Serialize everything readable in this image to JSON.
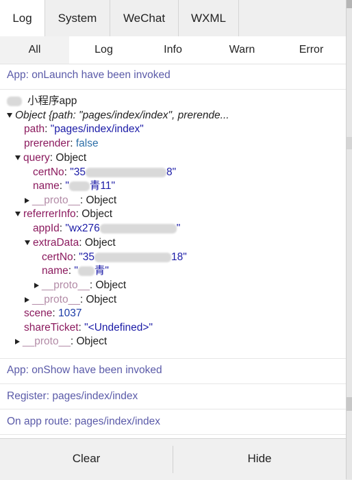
{
  "tabs": [
    "Log",
    "System",
    "WeChat",
    "WXML"
  ],
  "filters": [
    "All",
    "Log",
    "Info",
    "Warn",
    "Error"
  ],
  "logs": {
    "launch": "App: onLaunch have been invoked",
    "show": "App: onShow have been invoked",
    "register": "Register: pages/index/index",
    "route": "On app route: pages/index/index"
  },
  "obj": {
    "app_label": "小程序app",
    "summary": "Object {path: \"pages/index/index\", prerende...",
    "path_key": "path",
    "path_val": "\"pages/index/index\"",
    "prerender_key": "prerender",
    "prerender_val": "false",
    "query_key": "query",
    "object_word": "Object",
    "certNo_key": "certNo",
    "certNo_head": "\"35",
    "certNo_tail": "8\"",
    "certNo2_tail": "18\"",
    "name_key": "name",
    "name_head": "\"",
    "name_tail": "青11\"",
    "name2_tail": "青\"",
    "proto_key": "__proto__",
    "referrer_key": "referrerInfo",
    "appId_key": "appId",
    "appId_head": "\"wx276",
    "appId_tail": "\"",
    "extraData_key": "extraData",
    "scene_key": "scene",
    "scene_val": "1037",
    "shareTicket_key": "shareTicket",
    "shareTicket_val": "\"<Undefined>\""
  },
  "buttons": {
    "clear": "Clear",
    "hide": "Hide"
  }
}
